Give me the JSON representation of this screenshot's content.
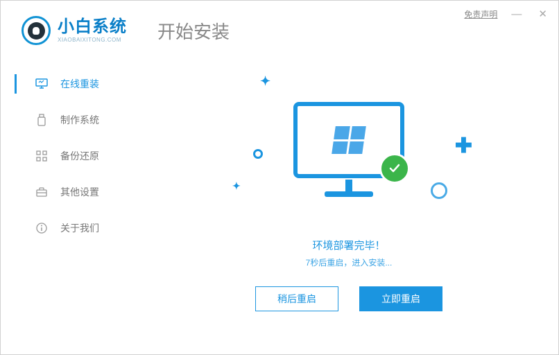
{
  "titlebar": {
    "disclaimer": "免责声明",
    "minimize": "—",
    "close": "✕"
  },
  "brand": {
    "name": "小白系统",
    "sub": "XIAOBAIXITONG.COM"
  },
  "page_title": "开始安装",
  "sidebar": {
    "items": [
      {
        "label": "在线重装",
        "active": true
      },
      {
        "label": "制作系统",
        "active": false
      },
      {
        "label": "备份还原",
        "active": false
      },
      {
        "label": "其他设置",
        "active": false
      },
      {
        "label": "关于我们",
        "active": false
      }
    ]
  },
  "status": {
    "main": "环境部署完毕！",
    "sub": "7秒后重启，进入安装..."
  },
  "buttons": {
    "later": "稍后重启",
    "now": "立即重启"
  }
}
